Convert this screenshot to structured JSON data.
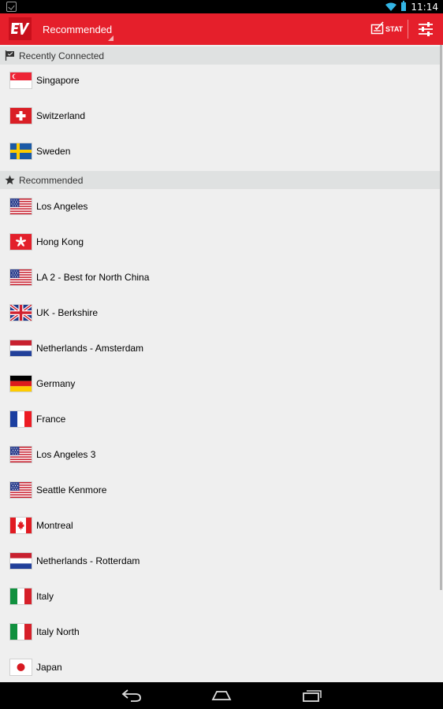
{
  "status_bar": {
    "time": "11:14",
    "icons": [
      "notification-check-icon",
      "wifi-icon",
      "battery-icon"
    ]
  },
  "action_bar": {
    "logo": "expressvpn-logo",
    "spinner_label": "Recommended",
    "stat_label": "STAT",
    "settings_icon": "sliders-icon"
  },
  "sections": {
    "recent": {
      "label": "Recently Connected",
      "icon": "flag-icon",
      "items": [
        {
          "label": "Singapore",
          "flag": "sg"
        },
        {
          "label": "Switzerland",
          "flag": "ch"
        },
        {
          "label": "Sweden",
          "flag": "se"
        }
      ]
    },
    "recommended": {
      "label": "Recommended",
      "icon": "star-icon",
      "items": [
        {
          "label": "Los Angeles",
          "flag": "us"
        },
        {
          "label": "Hong Kong",
          "flag": "hk"
        },
        {
          "label": "LA 2 - Best for North China",
          "flag": "us"
        },
        {
          "label": "UK - Berkshire",
          "flag": "gb"
        },
        {
          "label": "Netherlands - Amsterdam",
          "flag": "nl"
        },
        {
          "label": "Germany",
          "flag": "de"
        },
        {
          "label": "France",
          "flag": "fr"
        },
        {
          "label": "Los Angeles 3",
          "flag": "us"
        },
        {
          "label": "Seattle Kenmore",
          "flag": "us"
        },
        {
          "label": "Montreal",
          "flag": "ca"
        },
        {
          "label": "Netherlands - Rotterdam",
          "flag": "nl"
        },
        {
          "label": "Italy",
          "flag": "it"
        },
        {
          "label": "Italy North",
          "flag": "it"
        },
        {
          "label": "Japan",
          "flag": "jp"
        }
      ]
    }
  },
  "nav_bar": {
    "buttons": [
      "back-icon",
      "home-icon",
      "recent-apps-icon"
    ]
  },
  "colors": {
    "action_bar": "#e51f2b",
    "section_header": "#dfe1e1",
    "list_bg": "#efefef",
    "accent_blue": "#33b5e5"
  }
}
